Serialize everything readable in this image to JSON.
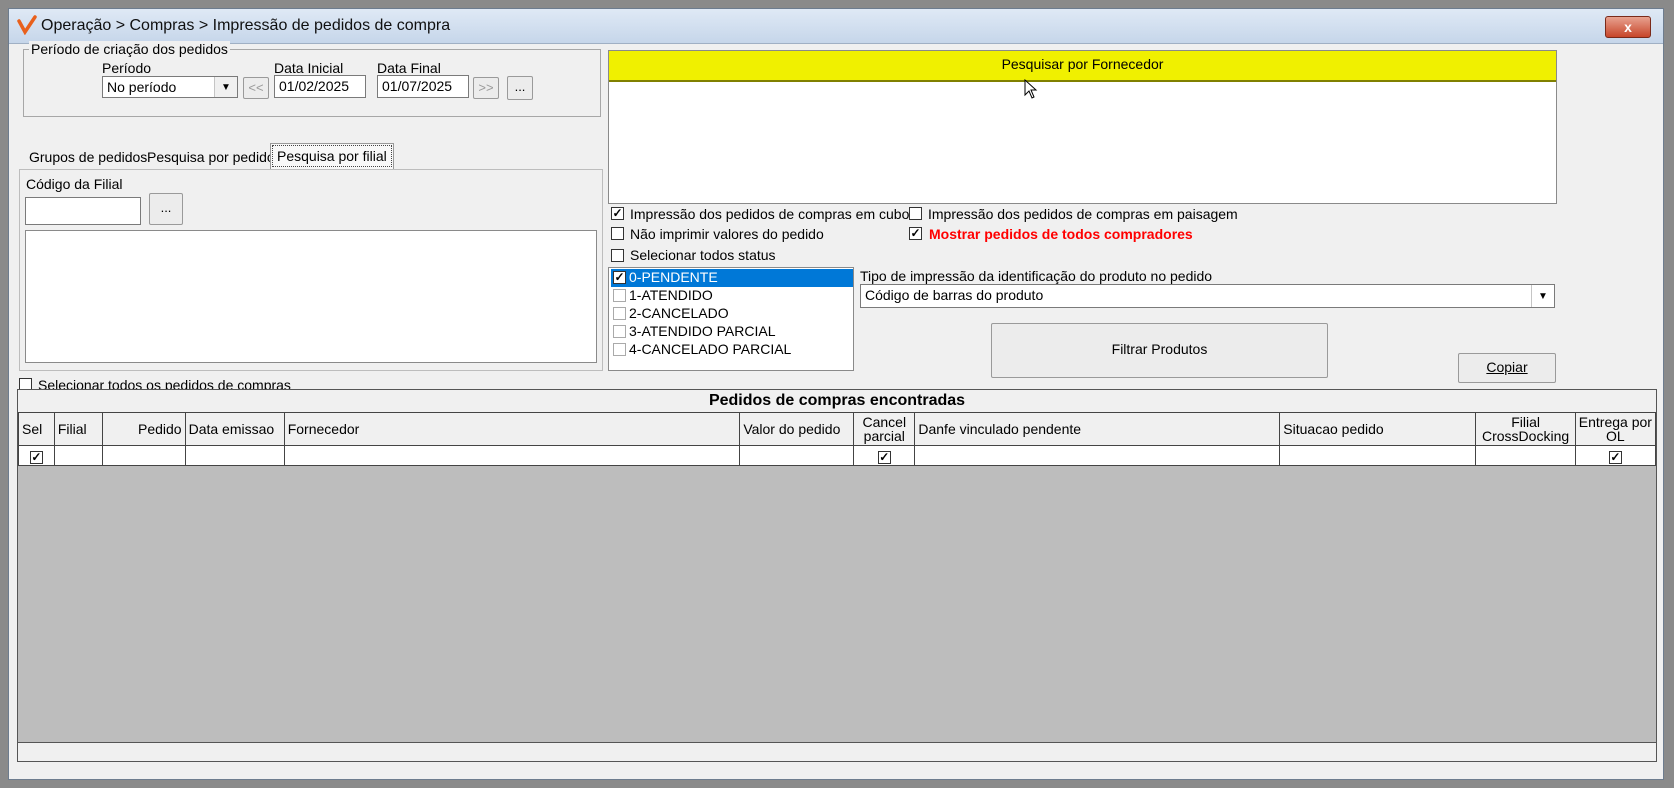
{
  "window": {
    "title": "Operação > Compras > Impressão de pedidos de compra",
    "close_label": "x"
  },
  "periodo": {
    "group_label": "Período de criação dos pedidos",
    "periodo_label": "Período",
    "periodo_value": "No período",
    "data_inicial_label": "Data Inicial",
    "data_inicial_value": "01/02/2025",
    "data_final_label": "Data Final",
    "data_final_value": "01/07/2025",
    "prev_label": "<<",
    "next_label": ">>",
    "more_label": "..."
  },
  "tabs": [
    {
      "label": "Grupos de pedidos"
    },
    {
      "label": "Pesquisa por pedido"
    },
    {
      "label": "Pesquisa por filial"
    }
  ],
  "filial": {
    "codigo_label": "Código da Filial",
    "codigo_value": "",
    "lookup_label": "..."
  },
  "selecionar_todos_pedidos": "Selecionar todos os pedidos de compras",
  "fornecedor": {
    "header": "Pesquisar por Fornecedor"
  },
  "options": {
    "cubo": {
      "label": "Impressão dos pedidos de compras em cubo",
      "checked": true
    },
    "paisagem": {
      "label": "Impressão dos pedidos de compras em paisagem",
      "checked": false
    },
    "nao_imprimir": {
      "label": "Não imprimir valores do pedido",
      "checked": false
    },
    "mostrar_todos": {
      "label": "Mostrar pedidos de todos compradores",
      "checked": true,
      "color": "#ff0000"
    },
    "selecionar_status": {
      "label": "Selecionar todos status",
      "checked": false
    }
  },
  "status_list": [
    {
      "label": "0-PENDENTE",
      "checked": true,
      "selected": true
    },
    {
      "label": "1-ATENDIDO",
      "checked": false,
      "selected": false
    },
    {
      "label": "2-CANCELADO",
      "checked": false,
      "selected": false
    },
    {
      "label": "3-ATENDIDO PARCIAL",
      "checked": false,
      "selected": false
    },
    {
      "label": "4-CANCELADO PARCIAL",
      "checked": false,
      "selected": false
    }
  ],
  "tipo_impressao": {
    "label": "Tipo de impressão da identificação do produto no pedido",
    "value": "Código de barras do produto"
  },
  "filtrar_label": "Filtrar Produtos",
  "copiar_label": "Copiar",
  "grid": {
    "title": "Pedidos de compras encontradas",
    "columns": [
      "Sel",
      "Filial",
      "Pedido",
      "Data emissao",
      "Fornecedor",
      "Valor do pedido",
      "Cancel parcial",
      "Danfe vinculado pendente",
      "Situacao pedido",
      "Filial CrossDocking",
      "Entrega por OL"
    ]
  },
  "colors": {
    "highlight_yellow": "#f0f000",
    "selection_blue": "#0078d7",
    "grid_empty": "#bdbdbd"
  }
}
